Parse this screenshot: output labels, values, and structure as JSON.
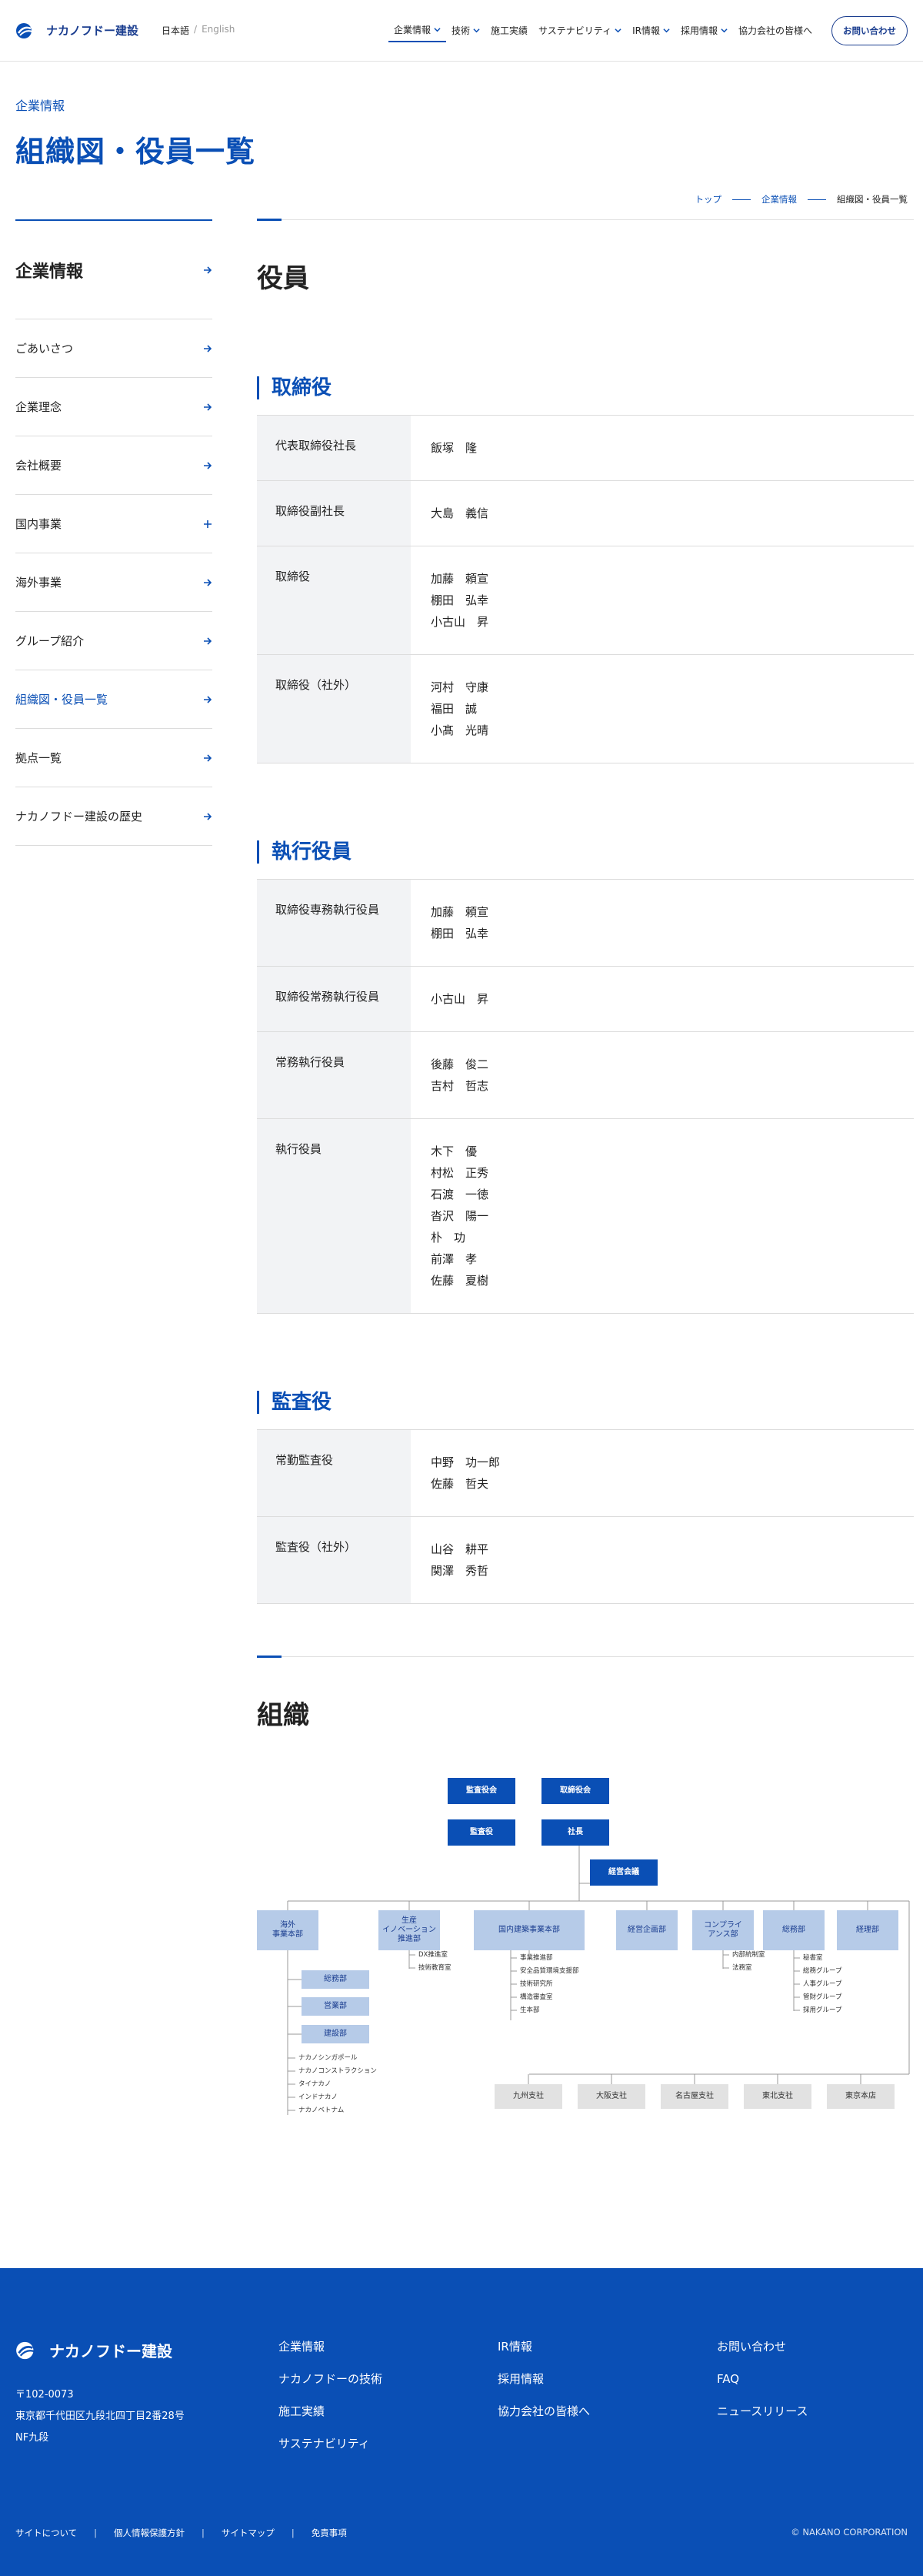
{
  "header": {
    "logo_text": "ナカノフドー建設",
    "lang_current": "日本語",
    "lang_sep": "/",
    "lang_other": "English",
    "nav": [
      {
        "label": "企業情報",
        "dropdown": true
      },
      {
        "label": "技術",
        "dropdown": true
      },
      {
        "label": "施工実績",
        "dropdown": false
      },
      {
        "label": "サステナビリティ",
        "dropdown": true
      },
      {
        "label": "IR情報",
        "dropdown": true
      },
      {
        "label": "採用情報",
        "dropdown": true
      },
      {
        "label": "協力会社の皆様へ",
        "dropdown": false
      }
    ],
    "contact_label": "お問い合わせ"
  },
  "page": {
    "eyebrow": "企業情報",
    "title": "組織図・役員一覧"
  },
  "breadcrumb": [
    "トップ",
    "企業情報",
    "組織図・役員一覧"
  ],
  "sidebar": {
    "title": "企業情報",
    "items": [
      {
        "label": "ごあいさつ",
        "icon": "arrow-right-icon"
      },
      {
        "label": "企業理念",
        "icon": "arrow-right-icon"
      },
      {
        "label": "会社概要",
        "icon": "arrow-right-icon"
      },
      {
        "label": "国内事業",
        "icon": "plus-icon"
      },
      {
        "label": "海外事業",
        "icon": "arrow-right-icon"
      },
      {
        "label": "グループ紹介",
        "icon": "arrow-right-icon"
      },
      {
        "label": "組織図・役員一覧",
        "icon": "arrow-right-icon",
        "current": true
      },
      {
        "label": "拠点一覧",
        "icon": "arrow-right-icon"
      },
      {
        "label": "ナカノフドー建設の歴史",
        "icon": "arrow-right-icon"
      }
    ]
  },
  "officers": {
    "title": "役員",
    "groups": [
      {
        "title": "取締役",
        "rows": [
          {
            "role": "代表取締役社長",
            "names": [
              "飯塚　隆"
            ]
          },
          {
            "role": "取締役副社長",
            "names": [
              "大島　義信"
            ]
          },
          {
            "role": "取締役",
            "names": [
              "加藤　頼宣",
              "棚田　弘幸",
              "小古山　昇"
            ]
          },
          {
            "role": "取締役（社外）",
            "names": [
              "河村　守康",
              "福田　誠",
              "小髙　光晴"
            ]
          }
        ]
      },
      {
        "title": "執行役員",
        "rows": [
          {
            "role": "取締役専務執行役員",
            "names": [
              "加藤　頼宣",
              "棚田　弘幸"
            ]
          },
          {
            "role": "取締役常務執行役員",
            "names": [
              "小古山　昇"
            ]
          },
          {
            "role": "常務執行役員",
            "names": [
              "後藤　俊二",
              "吉村　哲志"
            ]
          },
          {
            "role": "執行役員",
            "names": [
              "木下　優",
              "村松　正秀",
              "石渡　一徳",
              "沓沢　陽一",
              "朴　功",
              "前澤　孝",
              "佐藤　夏樹"
            ]
          }
        ]
      },
      {
        "title": "監査役",
        "rows": [
          {
            "role": "常勤監査役",
            "names": [
              "中野　功一郎",
              "佐藤　哲夫"
            ]
          },
          {
            "role": "監査役（社外）",
            "names": [
              "山谷　耕平",
              "関澤　秀哲"
            ]
          }
        ]
      }
    ]
  },
  "org": {
    "title": "組織",
    "top": {
      "audit_board": "監査役会",
      "board": "取締役会",
      "auditor": "監査役",
      "president": "社長",
      "management_meeting": "経営会議"
    },
    "divisions": {
      "overseas": "海外\n事業本部",
      "innovation": "生産\nイノベーション\n推進部",
      "domestic": "国内建築事業本部",
      "planning": "経営企画部",
      "compliance": "コンプライ\nアンス部",
      "general_affairs": "総務部",
      "accounting": "経理部"
    },
    "overseas_depts": [
      "総務部",
      "営業部",
      "建設部"
    ],
    "overseas_group": [
      "ナカノシンガポール",
      "ナカノコンストラクション",
      "タイナカノ",
      "インドナカノ",
      "ナカノベトナム"
    ],
    "innovation_sub": [
      "DX推進室",
      "技術教育室"
    ],
    "domestic_sub": [
      "事業推進部",
      "安全品質環境支援部",
      "技術研究所",
      "構造審査室",
      "生本部"
    ],
    "compliance_sub": [
      "内部統制室",
      "法務室"
    ],
    "general_sub": [
      "秘書室",
      "総務グループ",
      "人事グループ",
      "管財グループ",
      "採用グループ"
    ],
    "branches": [
      "九州支社",
      "大阪支社",
      "名古屋支社",
      "東北支社",
      "東京本店"
    ]
  },
  "footer": {
    "logo_text": "ナカノフドー建設",
    "postal": "〒102-0073",
    "address": "東京都千代田区九段北四丁目2番28号",
    "building": "NF九段",
    "col1": [
      "企業情報",
      "ナカノフドーの技術",
      "施工実績",
      "サステナビリティ"
    ],
    "col2": [
      "IR情報",
      "採用情報",
      "協力会社の皆様へ"
    ],
    "col3": [
      "お問い合わせ",
      "FAQ",
      "ニュースリリース"
    ],
    "bottom_links": [
      "サイトについて",
      "個人情報保護方針",
      "サイトマップ",
      "免責事項"
    ],
    "copyright": "© NAKANO CORPORATION"
  },
  "colors": {
    "brand": "#0a4fb5",
    "footer_bg": "#0a4fb5",
    "table_head_bg": "#f2f3f5"
  }
}
